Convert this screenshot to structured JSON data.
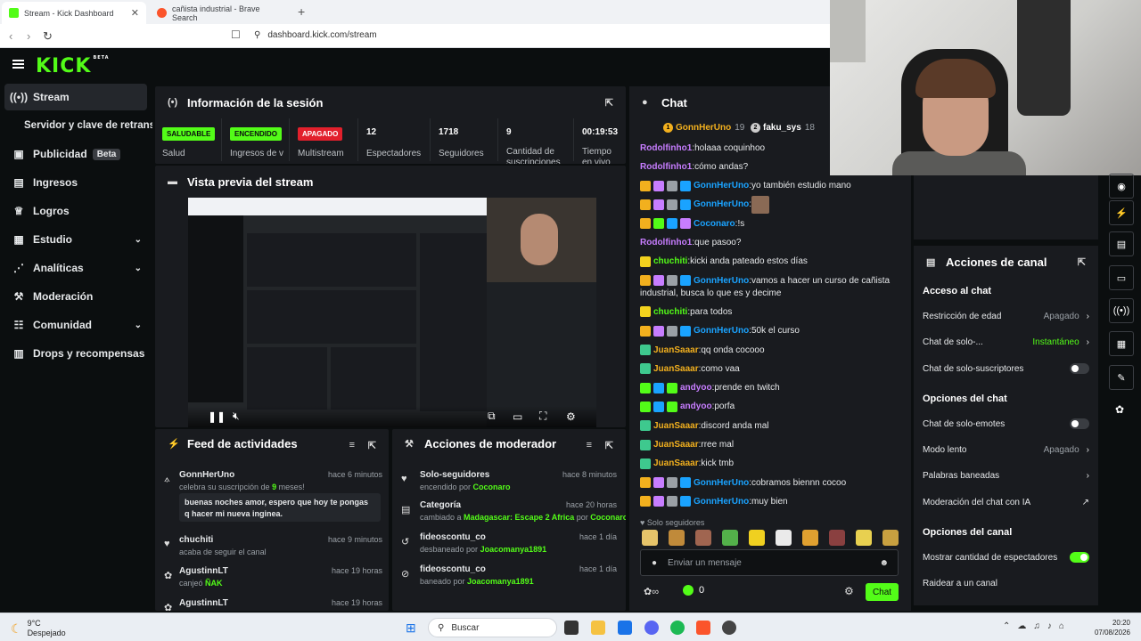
{
  "browser": {
    "tabs": [
      {
        "label": "Stream - Kick Dashboard",
        "color": "#53fc18"
      },
      {
        "label": "cañista industrial - Brave Search",
        "color": "#fb542b"
      }
    ],
    "url": "dashboard.kick.com/stream"
  },
  "brand": {
    "logo": "KICK",
    "beta": "BETA",
    "accent": "#53fc18"
  },
  "sidebar": {
    "items": [
      {
        "label": "Stream",
        "icon": "broadcast-icon"
      },
      {
        "label": "Servidor y clave de retransmisión",
        "icon": ""
      },
      {
        "label": "Publicidad",
        "icon": "ad-icon",
        "badge": "Beta"
      },
      {
        "label": "Ingresos",
        "icon": "chart-icon"
      },
      {
        "label": "Logros",
        "icon": "trophy-icon"
      },
      {
        "label": "Estudio",
        "icon": "grid-icon"
      },
      {
        "label": "Analíticas",
        "icon": "analytics-icon"
      },
      {
        "label": "Moderación",
        "icon": "hammer-icon"
      },
      {
        "label": "Comunidad",
        "icon": "people-icon"
      },
      {
        "label": "Drops y recompensas",
        "icon": "gift-icon"
      }
    ]
  },
  "session": {
    "title": "Información de la sesión",
    "stats": [
      {
        "badge": "SALUDABLE",
        "badge_color": "#53fc18",
        "label": "Salud"
      },
      {
        "badge": "ENCENDIDO",
        "badge_color": "#53fc18",
        "label": "Ingresos de video"
      },
      {
        "badge": "APAGADO",
        "badge_color": "#e2202c",
        "label": "Multistream"
      },
      {
        "value": "12",
        "label": "Espectadores"
      },
      {
        "value": "1718",
        "label": "Seguidores"
      },
      {
        "value": "9",
        "label": "Cantidad de suscripciones"
      },
      {
        "value": "00:19:53",
        "label": "Tiempo en vivo"
      }
    ]
  },
  "preview": {
    "title": "Vista previa del stream"
  },
  "activity": {
    "title": "Feed de actividades",
    "items": [
      {
        "name": "GonnHerUno",
        "time": "hace 6 minutos",
        "sub_pre": "celebra su suscripción de ",
        "sub_hl": "9",
        "sub_post": " meses!",
        "message": "buenas noches amor, espero que hoy te pongas q hacer mi nueva inginea."
      },
      {
        "name": "chuchiti",
        "time": "hace 9 minutos",
        "sub_pre": "acaba de seguir el canal",
        "sub_hl": "",
        "sub_post": ""
      },
      {
        "name": "AgustinnLT",
        "time": "hace 19 horas",
        "sub_pre": "canjeó ",
        "sub_hl": "ÑAK",
        "sub_post": ""
      },
      {
        "name": "AgustinnLT",
        "time": "hace 19 horas",
        "sub_pre": "",
        "sub_hl": "",
        "sub_post": ""
      }
    ]
  },
  "modactions": {
    "title": "Acciones de moderador",
    "items": [
      {
        "name": "Solo-seguidores",
        "time": "hace 8 minutos",
        "pre": "encendido por ",
        "hl1": "Coconaro",
        "mid": "",
        "hl2": ""
      },
      {
        "name": "Categoría",
        "time": "hace 20 horas",
        "pre": "cambiado a ",
        "hl1": "Madagascar: Escape 2 Africa",
        "mid": " por ",
        "hl2": "Coconaro"
      },
      {
        "name": "fideoscontu_co",
        "time": "hace 1 día",
        "pre": "desbaneado por ",
        "hl1": "Joacomanya1891",
        "mid": "",
        "hl2": ""
      },
      {
        "name": "fideoscontu_co",
        "time": "hace 1 día",
        "pre": "baneado por ",
        "hl1": "Joacomanya1891",
        "mid": "",
        "hl2": ""
      }
    ]
  },
  "chat": {
    "title": "Chat",
    "leaders": [
      {
        "rank": "1",
        "name": "GonnHerUno",
        "count": "19"
      },
      {
        "rank": "2",
        "name": "faku_sys",
        "count": "18"
      }
    ],
    "messages": [
      {
        "badges": [],
        "user": "Rodolfinho1",
        "color": "#c77dff",
        "text": "holaaa coquinhoo"
      },
      {
        "badges": [],
        "user": "Rodolfinho1",
        "color": "#c77dff",
        "text": "cómo andas?"
      },
      {
        "badges": [
          "crown",
          "sub",
          "og",
          "ver"
        ],
        "user": "GonnHerUno",
        "color": "#1aa3ff",
        "text": "yo también estudio mano"
      },
      {
        "badges": [
          "crown",
          "sub",
          "og",
          "ver"
        ],
        "user": "GonnHerUno",
        "color": "#1aa3ff",
        "text": "",
        "image": true
      },
      {
        "badges": [
          "crown",
          "mod",
          "ver",
          "sub"
        ],
        "user": "Coconaro",
        "color": "#1aa3ff",
        "text": "!s"
      },
      {
        "badges": [],
        "user": "Rodolfinho1",
        "color": "#c77dff",
        "text": "que pasoo?"
      },
      {
        "badges": [
          "num"
        ],
        "user": "chuchiti",
        "color": "#53fc18",
        "text": "kicki anda pateado estos días"
      },
      {
        "badges": [
          "crown",
          "sub",
          "og",
          "ver"
        ],
        "user": "GonnHerUno",
        "color": "#1aa3ff",
        "text": "vamos a hacer un curso de cañista",
        "text2": "industrial, busca lo que es y decime"
      },
      {
        "badges": [
          "num"
        ],
        "user": "chuchiti",
        "color": "#53fc18",
        "text": "para todos"
      },
      {
        "badges": [
          "crown",
          "sub",
          "og",
          "ver"
        ],
        "user": "GonnHerUno",
        "color": "#1aa3ff",
        "text": "50k el curso"
      },
      {
        "badges": [
          "tz"
        ],
        "user": "JuanSaaar",
        "color": "#f2b01e",
        "text": "qq onda cocooo"
      },
      {
        "badges": [
          "tz"
        ],
        "user": "JuanSaaar",
        "color": "#f2b01e",
        "text": "como vaa"
      },
      {
        "badges": [
          "mod",
          "ver",
          "mod"
        ],
        "user": "andyoo",
        "color": "#c77dff",
        "text": "prende en twitch"
      },
      {
        "badges": [
          "mod",
          "ver",
          "mod"
        ],
        "user": "andyoo",
        "color": "#c77dff",
        "text": "porfa"
      },
      {
        "badges": [
          "tz"
        ],
        "user": "JuanSaaar",
        "color": "#f2b01e",
        "text": "discord anda mal"
      },
      {
        "badges": [
          "tz"
        ],
        "user": "JuanSaaar",
        "color": "#f2b01e",
        "text": "rree mal"
      },
      {
        "badges": [
          "tz"
        ],
        "user": "JuanSaaar",
        "color": "#f2b01e",
        "text": "kick tmb"
      },
      {
        "badges": [
          "crown",
          "sub",
          "og",
          "ver"
        ],
        "user": "GonnHerUno",
        "color": "#1aa3ff",
        "text": "cobramos biennn cocoo"
      },
      {
        "badges": [
          "crown",
          "sub",
          "og",
          "ver"
        ],
        "user": "GonnHerUno",
        "color": "#1aa3ff",
        "text": "muy bien"
      }
    ],
    "mode_label": "Solo seguidores",
    "input_placeholder": "Enviar un mensaje",
    "points": "0",
    "send_label": "Chat"
  },
  "channel_actions": {
    "title": "Acciones de canal",
    "sections": [
      {
        "heading": "Acceso al chat",
        "rows": [
          {
            "label": "Restricción de edad",
            "value": "Apagado",
            "kind": "chev"
          },
          {
            "label": "Chat de solo-...",
            "value": "Instantáneo",
            "kind": "chev-green"
          },
          {
            "label": "Chat de solo-suscriptores",
            "value": "",
            "kind": "toggle-off"
          }
        ]
      },
      {
        "heading": "Opciones del chat",
        "rows": [
          {
            "label": "Chat de solo-emotes",
            "value": "",
            "kind": "toggle-off"
          },
          {
            "label": "Modo lento",
            "value": "Apagado",
            "kind": "chev"
          },
          {
            "label": "Palabras baneadas",
            "value": "",
            "kind": "chev"
          },
          {
            "label": "Moderación del chat con IA",
            "value": "",
            "kind": "ext"
          }
        ]
      },
      {
        "heading": "Opciones del canal",
        "rows": [
          {
            "label": "Mostrar cantidad de espectadores",
            "value": "",
            "kind": "toggle-on"
          },
          {
            "label": "Raidear a un canal",
            "value": "",
            "kind": "none"
          }
        ]
      }
    ]
  },
  "taskbar": {
    "weather_temp": "9°C",
    "weather_desc": "Despejado",
    "search_placeholder": "Buscar",
    "time": "20:20",
    "date": "07/08/2026"
  }
}
